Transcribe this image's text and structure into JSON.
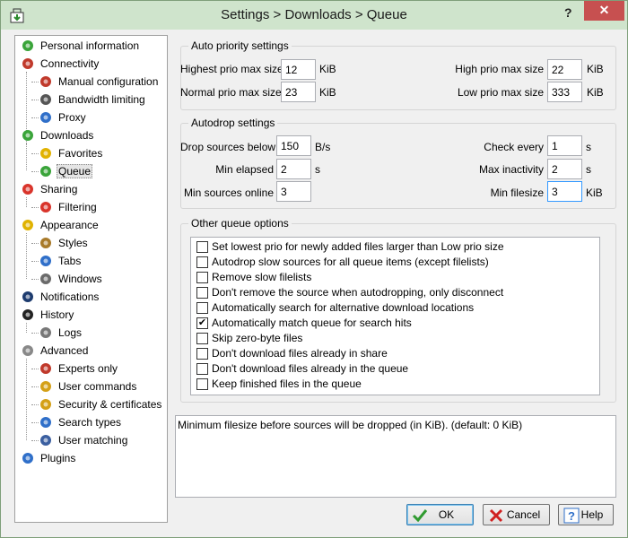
{
  "window": {
    "title": "Settings > Downloads > Queue",
    "help_glyph": "?",
    "close_glyph": "✕"
  },
  "tree": [
    {
      "label": "Personal information",
      "icon": "person-icon",
      "color": "#3aa43a"
    },
    {
      "label": "Connectivity",
      "icon": "antenna-icon",
      "color": "#c0392b"
    },
    {
      "label": "Manual configuration",
      "icon": "antenna-icon",
      "color": "#c0392b"
    },
    {
      "label": "Bandwidth limiting",
      "icon": "gauge-icon",
      "color": "#555555"
    },
    {
      "label": "Proxy",
      "icon": "globe-icon",
      "color": "#2f6fc9"
    },
    {
      "label": "Downloads",
      "icon": "down-arrow-icon",
      "color": "#3aa43a"
    },
    {
      "label": "Favorites",
      "icon": "favorites-icon",
      "color": "#e1b200"
    },
    {
      "label": "Queue",
      "icon": "queue-icon",
      "color": "#3aa43a"
    },
    {
      "label": "Sharing",
      "icon": "up-arrow-icon",
      "color": "#d9342b"
    },
    {
      "label": "Filtering",
      "icon": "up-arrow-icon",
      "color": "#d9342b"
    },
    {
      "label": "Appearance",
      "icon": "palette-icon",
      "color": "#e0b200"
    },
    {
      "label": "Styles",
      "icon": "brush-icon",
      "color": "#a87a2a"
    },
    {
      "label": "Tabs",
      "icon": "tabs-icon",
      "color": "#2f6fc9"
    },
    {
      "label": "Windows",
      "icon": "window-icon",
      "color": "#6a6a6a"
    },
    {
      "label": "Notifications",
      "icon": "notification-icon",
      "color": "#1d3b6e"
    },
    {
      "label": "History",
      "icon": "clock-icon",
      "color": "#222222"
    },
    {
      "label": "Logs",
      "icon": "log-icon",
      "color": "#777777"
    },
    {
      "label": "Advanced",
      "icon": "gears-icon",
      "color": "#888888"
    },
    {
      "label": "Experts only",
      "icon": "tools-icon",
      "color": "#c0392b"
    },
    {
      "label": "User commands",
      "icon": "lock-icon",
      "color": "#d4a017"
    },
    {
      "label": "Security & certificates",
      "icon": "key-icon",
      "color": "#d4a017"
    },
    {
      "label": "Search types",
      "icon": "search-icon",
      "color": "#2f6fc9"
    },
    {
      "label": "User matching",
      "icon": "users-icon",
      "color": "#3b5fa0"
    },
    {
      "label": "Plugins",
      "icon": "puzzle-icon",
      "color": "#2f6fc9"
    }
  ],
  "auto_priority": {
    "title": "Auto priority settings",
    "highest_label": "Highest prio max size",
    "highest_value": "12",
    "highest_unit": "KiB",
    "high_label": "High prio max size",
    "high_value": "22",
    "high_unit": "KiB",
    "normal_label": "Normal prio max size",
    "normal_value": "23",
    "normal_unit": "KiB",
    "low_label": "Low prio max size",
    "low_value": "333",
    "low_unit": "KiB"
  },
  "autodrop": {
    "title": "Autodrop settings",
    "drop_label": "Drop sources below",
    "drop_value": "150",
    "drop_unit": "B/s",
    "check_label": "Check every",
    "check_value": "1",
    "check_unit": "s",
    "elapsed_label": "Min elapsed",
    "elapsed_value": "2",
    "elapsed_unit": "s",
    "inactivity_label": "Max inactivity",
    "inactivity_value": "2",
    "inactivity_unit": "s",
    "online_label": "Min sources online",
    "online_value": "3",
    "filesize_label": "Min filesize",
    "filesize_value": "3",
    "filesize_unit": "KiB"
  },
  "other": {
    "title": "Other queue options",
    "options": [
      {
        "label": "Set lowest prio for newly added files larger than Low prio size",
        "checked": false
      },
      {
        "label": "Autodrop slow sources for all queue items (except filelists)",
        "checked": false
      },
      {
        "label": "Remove slow filelists",
        "checked": false
      },
      {
        "label": "Don't remove the source when autodropping, only disconnect",
        "checked": false
      },
      {
        "label": "Automatically search for alternative download locations",
        "checked": false
      },
      {
        "label": "Automatically match queue for search hits",
        "checked": true
      },
      {
        "label": "Skip zero-byte files",
        "checked": false
      },
      {
        "label": "Don't download files already in share",
        "checked": false
      },
      {
        "label": "Don't download files already in the queue",
        "checked": false
      },
      {
        "label": "Keep finished files in the queue",
        "checked": false
      }
    ]
  },
  "description": "Minimum filesize before sources will be dropped (in KiB). (default: 0 KiB)",
  "buttons": {
    "ok": "OK",
    "cancel": "Cancel",
    "help": "Help"
  }
}
